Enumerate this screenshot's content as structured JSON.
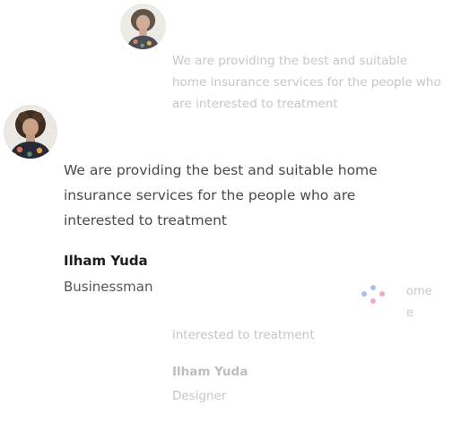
{
  "testimonials": {
    "faded_top": {
      "avatar": "person-avatar-icon",
      "quote": "We are providing the best and suitable home insurance services for the people who are interested to treatment"
    },
    "main": {
      "avatar": "person-avatar-icon",
      "quote": "We are providing the best and suitable home insurance services for the people who are interested to treatment",
      "name": "Ilham Yuda",
      "role": "Businessman"
    },
    "faded_bottom": {
      "quote_fragment_1": "ome",
      "quote_fragment_2": "e",
      "quote_last_line": "interested to treatment",
      "name": "Ilham Yuda",
      "role": "Designer"
    }
  },
  "loader": {
    "icon": "loading-dots-icon",
    "colors": [
      "#a9bff2",
      "#f2a9c9",
      "#a9bff2",
      "#f2a9c9"
    ]
  }
}
